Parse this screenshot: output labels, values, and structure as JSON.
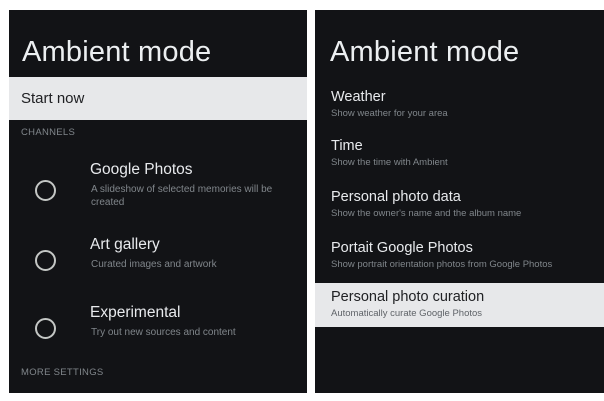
{
  "left": {
    "title": "Ambient mode",
    "start_now": "Start now",
    "channels_header": "CHANNELS",
    "channels": [
      {
        "title": "Google Photos",
        "subtitle": "A slideshow of selected memories will be created"
      },
      {
        "title": "Art gallery",
        "subtitle": "Curated images and artwork"
      },
      {
        "title": "Experimental",
        "subtitle": "Try out new sources and content"
      }
    ],
    "more_settings_header": "MORE SETTINGS"
  },
  "right": {
    "title": "Ambient mode",
    "settings": [
      {
        "title": "Weather",
        "subtitle": "Show weather for your area"
      },
      {
        "title": "Time",
        "subtitle": "Show the time with Ambient"
      },
      {
        "title": "Personal photo data",
        "subtitle": "Show the owner's name and the album name"
      },
      {
        "title": "Portait Google Photos",
        "subtitle": "Show portrait orientation photos from Google Photos"
      },
      {
        "title": "Personal photo curation",
        "subtitle": "Automatically curate Google Photos",
        "selected": true
      }
    ]
  },
  "colors": {
    "panel_bg": "#121316",
    "highlight_bg": "#e7e8ea",
    "text_primary": "#e8eaed",
    "text_secondary": "#80868b"
  }
}
